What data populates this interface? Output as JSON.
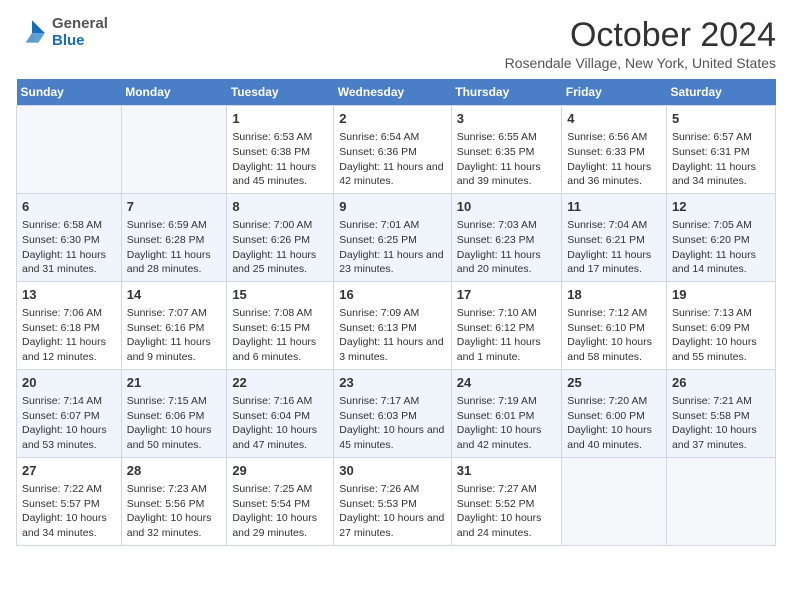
{
  "header": {
    "logo": {
      "general": "General",
      "blue": "Blue"
    },
    "title": "October 2024",
    "location": "Rosendale Village, New York, United States"
  },
  "days_of_week": [
    "Sunday",
    "Monday",
    "Tuesday",
    "Wednesday",
    "Thursday",
    "Friday",
    "Saturday"
  ],
  "weeks": [
    [
      {
        "day": "",
        "info": ""
      },
      {
        "day": "",
        "info": ""
      },
      {
        "day": "1",
        "info": "Sunrise: 6:53 AM\nSunset: 6:38 PM\nDaylight: 11 hours and 45 minutes."
      },
      {
        "day": "2",
        "info": "Sunrise: 6:54 AM\nSunset: 6:36 PM\nDaylight: 11 hours and 42 minutes."
      },
      {
        "day": "3",
        "info": "Sunrise: 6:55 AM\nSunset: 6:35 PM\nDaylight: 11 hours and 39 minutes."
      },
      {
        "day": "4",
        "info": "Sunrise: 6:56 AM\nSunset: 6:33 PM\nDaylight: 11 hours and 36 minutes."
      },
      {
        "day": "5",
        "info": "Sunrise: 6:57 AM\nSunset: 6:31 PM\nDaylight: 11 hours and 34 minutes."
      }
    ],
    [
      {
        "day": "6",
        "info": "Sunrise: 6:58 AM\nSunset: 6:30 PM\nDaylight: 11 hours and 31 minutes."
      },
      {
        "day": "7",
        "info": "Sunrise: 6:59 AM\nSunset: 6:28 PM\nDaylight: 11 hours and 28 minutes."
      },
      {
        "day": "8",
        "info": "Sunrise: 7:00 AM\nSunset: 6:26 PM\nDaylight: 11 hours and 25 minutes."
      },
      {
        "day": "9",
        "info": "Sunrise: 7:01 AM\nSunset: 6:25 PM\nDaylight: 11 hours and 23 minutes."
      },
      {
        "day": "10",
        "info": "Sunrise: 7:03 AM\nSunset: 6:23 PM\nDaylight: 11 hours and 20 minutes."
      },
      {
        "day": "11",
        "info": "Sunrise: 7:04 AM\nSunset: 6:21 PM\nDaylight: 11 hours and 17 minutes."
      },
      {
        "day": "12",
        "info": "Sunrise: 7:05 AM\nSunset: 6:20 PM\nDaylight: 11 hours and 14 minutes."
      }
    ],
    [
      {
        "day": "13",
        "info": "Sunrise: 7:06 AM\nSunset: 6:18 PM\nDaylight: 11 hours and 12 minutes."
      },
      {
        "day": "14",
        "info": "Sunrise: 7:07 AM\nSunset: 6:16 PM\nDaylight: 11 hours and 9 minutes."
      },
      {
        "day": "15",
        "info": "Sunrise: 7:08 AM\nSunset: 6:15 PM\nDaylight: 11 hours and 6 minutes."
      },
      {
        "day": "16",
        "info": "Sunrise: 7:09 AM\nSunset: 6:13 PM\nDaylight: 11 hours and 3 minutes."
      },
      {
        "day": "17",
        "info": "Sunrise: 7:10 AM\nSunset: 6:12 PM\nDaylight: 11 hours and 1 minute."
      },
      {
        "day": "18",
        "info": "Sunrise: 7:12 AM\nSunset: 6:10 PM\nDaylight: 10 hours and 58 minutes."
      },
      {
        "day": "19",
        "info": "Sunrise: 7:13 AM\nSunset: 6:09 PM\nDaylight: 10 hours and 55 minutes."
      }
    ],
    [
      {
        "day": "20",
        "info": "Sunrise: 7:14 AM\nSunset: 6:07 PM\nDaylight: 10 hours and 53 minutes."
      },
      {
        "day": "21",
        "info": "Sunrise: 7:15 AM\nSunset: 6:06 PM\nDaylight: 10 hours and 50 minutes."
      },
      {
        "day": "22",
        "info": "Sunrise: 7:16 AM\nSunset: 6:04 PM\nDaylight: 10 hours and 47 minutes."
      },
      {
        "day": "23",
        "info": "Sunrise: 7:17 AM\nSunset: 6:03 PM\nDaylight: 10 hours and 45 minutes."
      },
      {
        "day": "24",
        "info": "Sunrise: 7:19 AM\nSunset: 6:01 PM\nDaylight: 10 hours and 42 minutes."
      },
      {
        "day": "25",
        "info": "Sunrise: 7:20 AM\nSunset: 6:00 PM\nDaylight: 10 hours and 40 minutes."
      },
      {
        "day": "26",
        "info": "Sunrise: 7:21 AM\nSunset: 5:58 PM\nDaylight: 10 hours and 37 minutes."
      }
    ],
    [
      {
        "day": "27",
        "info": "Sunrise: 7:22 AM\nSunset: 5:57 PM\nDaylight: 10 hours and 34 minutes."
      },
      {
        "day": "28",
        "info": "Sunrise: 7:23 AM\nSunset: 5:56 PM\nDaylight: 10 hours and 32 minutes."
      },
      {
        "day": "29",
        "info": "Sunrise: 7:25 AM\nSunset: 5:54 PM\nDaylight: 10 hours and 29 minutes."
      },
      {
        "day": "30",
        "info": "Sunrise: 7:26 AM\nSunset: 5:53 PM\nDaylight: 10 hours and 27 minutes."
      },
      {
        "day": "31",
        "info": "Sunrise: 7:27 AM\nSunset: 5:52 PM\nDaylight: 10 hours and 24 minutes."
      },
      {
        "day": "",
        "info": ""
      },
      {
        "day": "",
        "info": ""
      }
    ]
  ]
}
